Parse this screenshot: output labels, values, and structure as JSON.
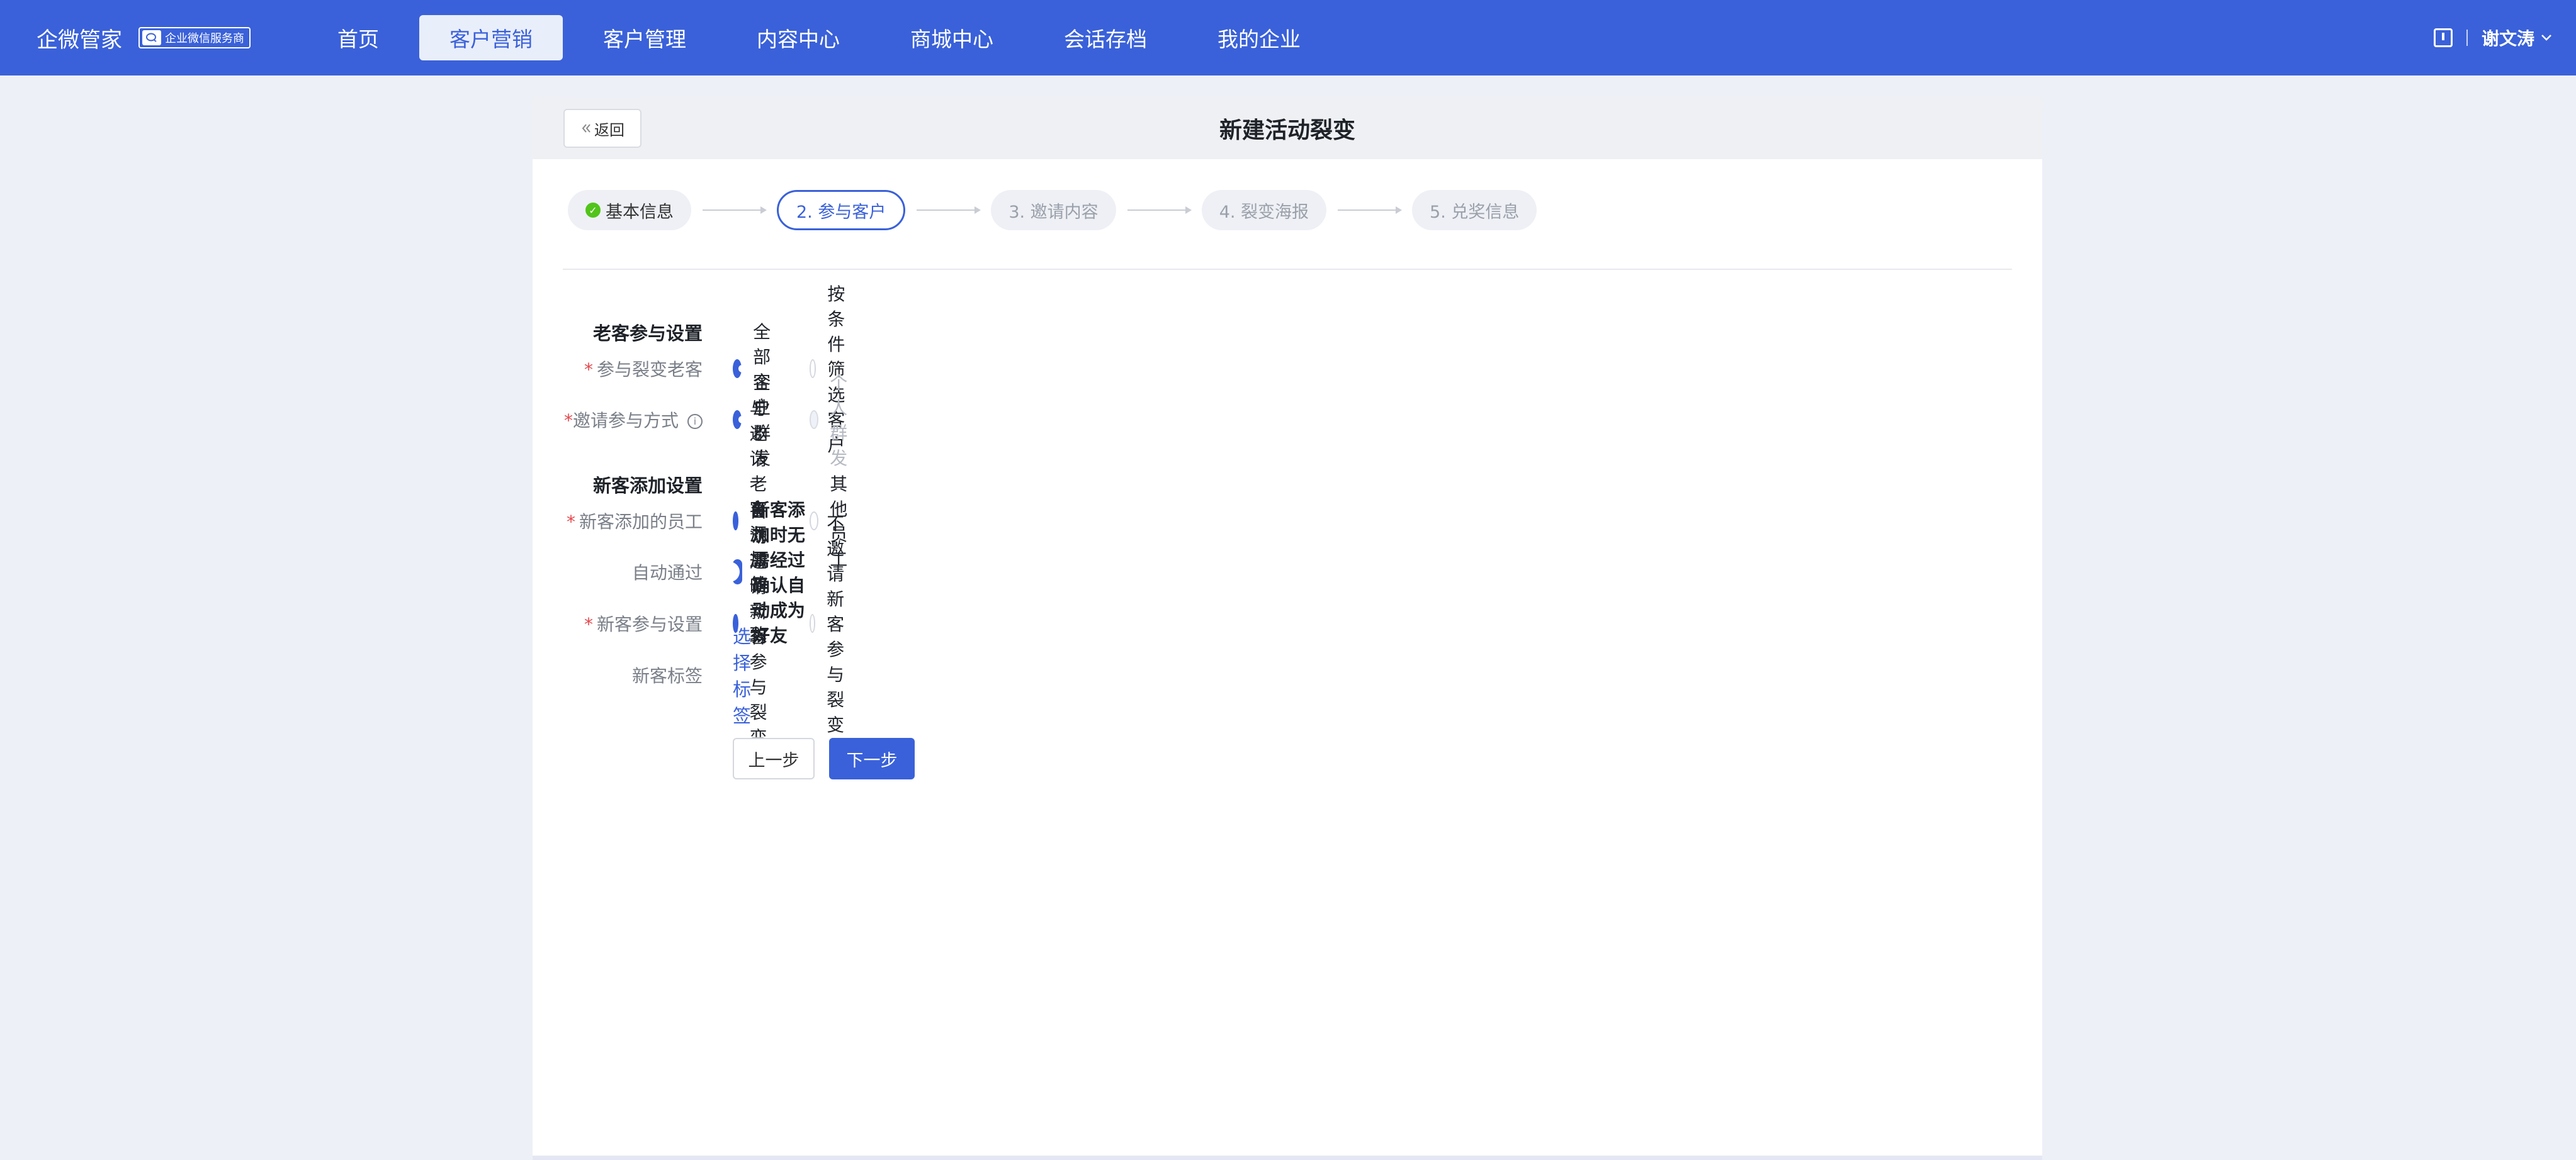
{
  "brand": {
    "name": "企微管家",
    "badge": "企业微信服务商"
  },
  "nav": {
    "items": [
      "首页",
      "客户营销",
      "客户管理",
      "内容中心",
      "商城中心",
      "会话存档",
      "我的企业"
    ],
    "active_index": 1
  },
  "user": {
    "name": "谢文涛"
  },
  "header": {
    "back_label": "返回",
    "title": "新建活动裂变"
  },
  "steps": [
    {
      "label": "基本信息",
      "state": "done"
    },
    {
      "label": "2. 参与客户",
      "state": "current"
    },
    {
      "label": "3. 邀请内容",
      "state": "pending"
    },
    {
      "label": "4. 裂变海报",
      "state": "pending"
    },
    {
      "label": "5. 兑奖信息",
      "state": "pending"
    }
  ],
  "old_customer": {
    "section_title": "老客参与设置",
    "participants": {
      "label": "参与裂变老客",
      "options": [
        "全部客户",
        "按条件筛选客户"
      ],
      "selected": "全部客户"
    },
    "invite_method": {
      "label": "邀请参与方式",
      "options": [
        "企业群发",
        "个人群发"
      ],
      "selected": "企业群发",
      "disabled": "个人群发"
    }
  },
  "new_customer": {
    "section_title": "新客添加设置",
    "staff": {
      "label": "新客添加的员工",
      "options": [
        "与邀请老客添加的一致",
        "其他员工"
      ],
      "selected": "与邀请老客添加的一致"
    },
    "auto_pass": {
      "label": "自动通过",
      "enabled": true,
      "text": "新客添加时无需经过确认自动成为好友"
    },
    "participation": {
      "label": "新客参与设置",
      "options": [
        "自动邀请新客参与裂变",
        "不邀请新客参与裂变"
      ],
      "selected": "自动邀请新客参与裂变"
    },
    "tags": {
      "label": "新客标签",
      "link": "选择标签"
    }
  },
  "actions": {
    "prev": "上一步",
    "next": "下一步"
  },
  "colors": {
    "primary": "#3a61d9",
    "required": "#e5484d",
    "done": "#52c41a"
  }
}
